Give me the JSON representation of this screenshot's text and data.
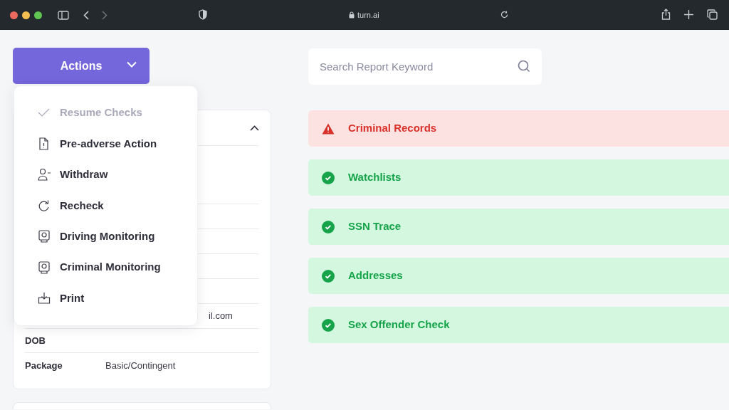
{
  "browser": {
    "address": "turn.ai"
  },
  "actions_button": {
    "label": "Actions",
    "expanded": true
  },
  "actions_menu": [
    {
      "label": "Resume Checks",
      "kind": "check",
      "disabled": true
    },
    {
      "label": "Pre-adverse Action",
      "kind": "document",
      "disabled": false
    },
    {
      "label": "Withdraw",
      "kind": "user-minus",
      "disabled": false
    },
    {
      "label": "Recheck",
      "kind": "refresh",
      "disabled": false
    },
    {
      "label": "Driving Monitoring",
      "kind": "monitor",
      "disabled": false
    },
    {
      "label": "Criminal Monitoring",
      "kind": "monitor",
      "disabled": false
    },
    {
      "label": "Print",
      "kind": "download",
      "disabled": false
    }
  ],
  "details_card": {
    "expanded": true,
    "rows": [
      {
        "label": "",
        "value": "il.com"
      },
      {
        "label": "DOB",
        "value": ""
      },
      {
        "label": "Package",
        "value": "Basic/Contingent"
      }
    ]
  },
  "search": {
    "placeholder": "Search Report Keyword"
  },
  "checks": [
    {
      "label": "Criminal Records",
      "kind": "alert"
    },
    {
      "label": "Watchlists",
      "kind": "clear"
    },
    {
      "label": "SSN Trace",
      "kind": "clear"
    },
    {
      "label": "Addresses",
      "kind": "clear"
    },
    {
      "label": "Sex Offender Check",
      "kind": "clear"
    }
  ]
}
